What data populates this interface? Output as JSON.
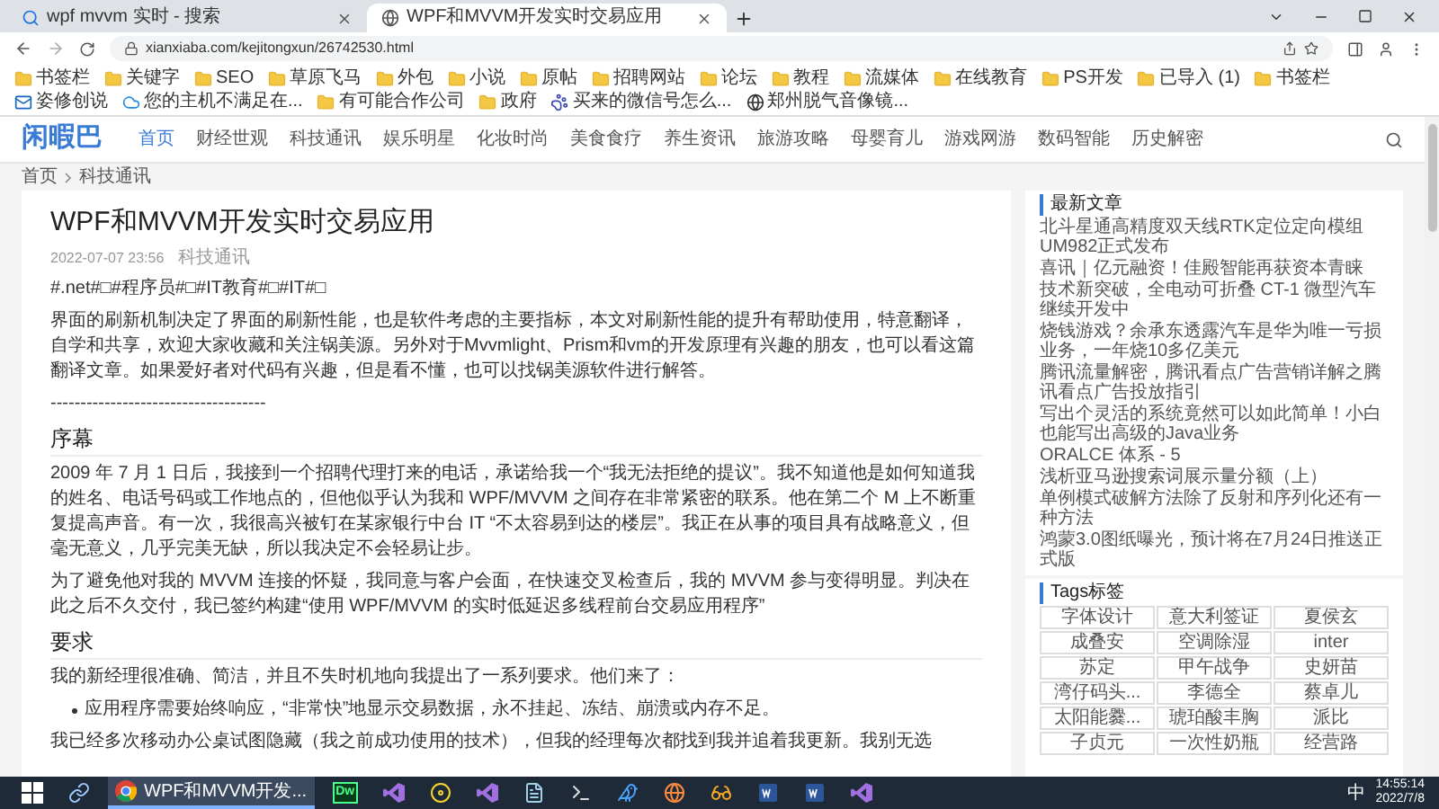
{
  "browser": {
    "tabs": [
      {
        "title": "wpf mvvm 实时 - 搜索",
        "kind": "search",
        "selected": false
      },
      {
        "title": "WPF和MVVM开发实时交易应用",
        "kind": "globe",
        "selected": true
      }
    ],
    "url": "xianxiaba.com/kejitongxun/26742530.html",
    "bookmarks": [
      {
        "label": "书签栏",
        "kind": "folder"
      },
      {
        "label": "关键字",
        "kind": "folder"
      },
      {
        "label": "SEO",
        "kind": "folder"
      },
      {
        "label": "草原飞马",
        "kind": "folder"
      },
      {
        "label": "外包",
        "kind": "folder"
      },
      {
        "label": "小说",
        "kind": "folder"
      },
      {
        "label": "原帖",
        "kind": "folder"
      },
      {
        "label": "招聘网站",
        "kind": "folder"
      },
      {
        "label": "论坛",
        "kind": "folder"
      },
      {
        "label": "教程",
        "kind": "folder"
      },
      {
        "label": "流媒体",
        "kind": "folder"
      },
      {
        "label": "在线教育",
        "kind": "folder"
      },
      {
        "label": "PS开发",
        "kind": "folder"
      },
      {
        "label": "已导入 (1)",
        "kind": "folder"
      },
      {
        "label": "书签栏",
        "kind": "folder"
      },
      {
        "label": "姿修创说",
        "kind": "mail"
      },
      {
        "label": "您的主机不满足在...",
        "kind": "cloud"
      },
      {
        "label": "有可能合作公司",
        "kind": "folder"
      },
      {
        "label": "政府",
        "kind": "folder"
      },
      {
        "label": "买来的微信号怎么...",
        "kind": "paw"
      },
      {
        "label": "郑州脱气音像镜...",
        "kind": "globe"
      }
    ]
  },
  "site": {
    "logo": "闲暇巴",
    "nav": [
      {
        "label": "首页",
        "selected": true
      },
      {
        "label": "财经世观",
        "selected": false
      },
      {
        "label": "科技通讯",
        "selected": false
      },
      {
        "label": "娱乐明星",
        "selected": false
      },
      {
        "label": "化妆时尚",
        "selected": false
      },
      {
        "label": "美食食疗",
        "selected": false
      },
      {
        "label": "养生资讯",
        "selected": false
      },
      {
        "label": "旅游攻略",
        "selected": false
      },
      {
        "label": "母婴育儿",
        "selected": false
      },
      {
        "label": "游戏网游",
        "selected": false
      },
      {
        "label": "数码智能",
        "selected": false
      },
      {
        "label": "历史解密",
        "selected": false
      }
    ],
    "breadcrumb": [
      "首页",
      "科技通讯"
    ]
  },
  "article": {
    "title": "WPF和MVVM开发实时交易应用",
    "date": "2022-07-07 23:56",
    "category": "科技通讯",
    "blocks": [
      {
        "kind": "p",
        "text": "#.net#□#程序员#□#IT教育#□#IT#□"
      },
      {
        "kind": "p",
        "text": "界面的刷新机制决定了界面的刷新性能，也是软件考虑的主要指标，本文对刷新性能的提升有帮助使用，特意翻译，自学和共享，欢迎大家收藏和关注锅美源。另外对于Mvvmlight、Prism和vm的开发原理有兴趣的朋友，也可以看这篇翻译文章。如果爱好者对代码有兴趣，但是看不懂，也可以找锅美源软件进行解答。"
      },
      {
        "kind": "p",
        "text": "------------------------------------"
      },
      {
        "kind": "h",
        "text": "序幕"
      },
      {
        "kind": "p",
        "text": "2009 年 7 月 1 日后，我接到一个招聘代理打来的电话，承诺给我一个“我无法拒绝的提议”。我不知道他是如何知道我的姓名、电话号码或工作地点的，但他似乎认为我和 WPF/MVVM 之间存在非常紧密的联系。他在第二个 M 上不断重复提高声音。有一次，我很高兴被钉在某家银行中台 IT “不太容易到达的楼层”。我正在从事的项目具有战略意义，但毫无意义，几乎完美无缺，所以我决定不会轻易让步。"
      },
      {
        "kind": "p",
        "text": "为了避免他对我的 MVVM 连接的怀疑，我同意与客户会面，在快速交叉检查后，我的 MVVM 参与变得明显。判决在此之后不久交付，我已签约构建“使用 WPF/MVVM 的实时低延迟多线程前台交易应用程序”"
      },
      {
        "kind": "h",
        "text": "要求"
      },
      {
        "kind": "p",
        "text": "我的新经理很准确、简洁，并且不失时机地向我提出了一系列要求。他们来了："
      },
      {
        "kind": "li",
        "text": "应用程序需要始终响应，“非常快”地显示交易数据，永不挂起、冻结、崩溃或内存不足。"
      },
      {
        "kind": "p",
        "text": "我已经多次移动办公桌试图隐藏（我之前成功使用的技术），但我的经理每次都找到我并追着我更新。我别无选"
      }
    ]
  },
  "sidebar": {
    "latest_title": "最新文章",
    "latest": [
      "北斗星通高精度双天线RTK定位定向模组UM982正式发布",
      "喜讯｜亿元融资！佳殿智能再获资本青睐",
      "技术新突破，全电动可折叠 CT-1 微型汽车继续开发中",
      "烧钱游戏？余承东透露汽车是华为唯一亏损业务，一年烧10多亿美元",
      "腾讯流量解密，腾讯看点广告营销详解之腾讯看点广告投放指引",
      "写出个灵活的系统竟然可以如此简单！小白也能写出高级的Java业务",
      "ORALCE 体系 - 5",
      "浅析亚马逊搜索词展示量分额（上）",
      "单例模式破解方法除了反射和序列化还有一种方法",
      "鸿蒙3.0图纸曝光，预计将在7月24日推送正式版"
    ],
    "tags_title": "Tags标签",
    "tags": [
      "字体设计",
      "意大利签证",
      "夏侯玄",
      "成叠安",
      "空调除湿",
      "inter",
      "苏定",
      "甲午战争",
      "史妍苗",
      "湾仔码头...",
      "李德全",
      "蔡卓儿",
      "太阳能爨...",
      "琥珀酸丰胸",
      "派比",
      "子贞元",
      "一次性奶瓶",
      "经营路"
    ]
  },
  "taskbar": {
    "apps": [
      {
        "kind": "windows"
      },
      {
        "kind": "link"
      },
      {
        "kind": "chrome",
        "label": "WPF和MVVM开发...",
        "selected": true
      },
      {
        "kind": "dw",
        "label": "Dw",
        "selected": false
      },
      {
        "kind": "vs",
        "selected": false
      },
      {
        "kind": "disc",
        "selected": false
      },
      {
        "kind": "vs",
        "selected": false
      },
      {
        "kind": "file",
        "selected": false
      },
      {
        "kind": "terminal",
        "selected": false
      },
      {
        "kind": "bird",
        "selected": false
      },
      {
        "kind": "firefox",
        "selected": false
      },
      {
        "kind": "glasses",
        "selected": false
      },
      {
        "kind": "word",
        "selected": false
      },
      {
        "kind": "word",
        "selected": false
      },
      {
        "kind": "vs",
        "selected": false
      }
    ],
    "ime": "中",
    "time": "14:55:14",
    "date": "2022/7/8"
  }
}
